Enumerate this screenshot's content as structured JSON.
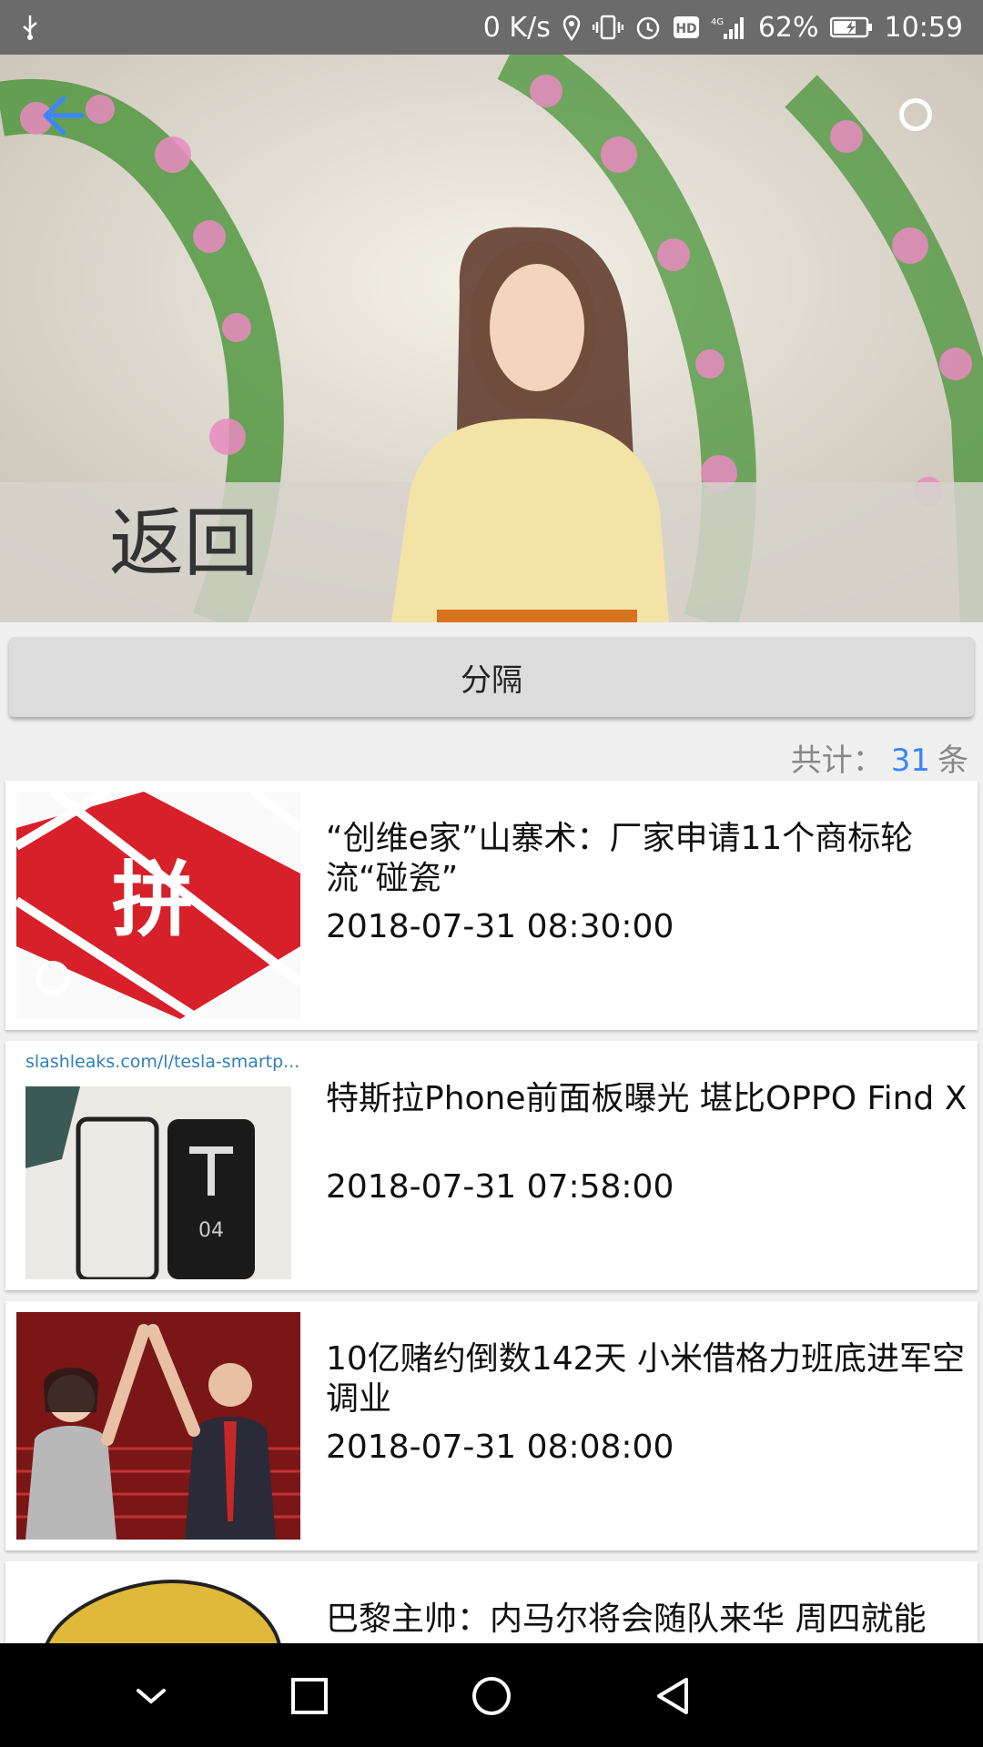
{
  "status_bar": {
    "net_speed": "0 K/s",
    "battery": "62%",
    "time": "10:59",
    "icons": [
      "usb-icon",
      "location-icon",
      "vibrate-icon",
      "alarm-icon",
      "hd-icon",
      "signal-4g-icon",
      "battery-charging-icon"
    ]
  },
  "hero": {
    "back_label": "返回",
    "back_icon": "arrow-left-icon",
    "search_icon": "search-icon",
    "accent": "#3b86ff"
  },
  "divider": {
    "label": "分隔"
  },
  "count": {
    "prefix": "共计：",
    "value": "31",
    "suffix": "条"
  },
  "news": [
    {
      "title": "“创维e家”山寨术：厂家申请11个商标轮流“碰瓷”",
      "date": "2018-07-31 08:30:00"
    },
    {
      "title": "特斯拉Phone前面板曝光 堪比OPPO Find X",
      "date": "2018-07-31 07:58:00",
      "source": "slashleaks.com/l/tesla-smartp..."
    },
    {
      "title": "10亿赌约倒数142天 小米借格力班底进军空调业",
      "date": "2018-07-31 08:08:00"
    },
    {
      "title": "巴黎主帅：内马尔将会随队来华 周四就能",
      "date": ""
    }
  ],
  "nav": {
    "icons": [
      "chevron-down-icon",
      "recents-icon",
      "home-icon",
      "back-icon"
    ]
  }
}
